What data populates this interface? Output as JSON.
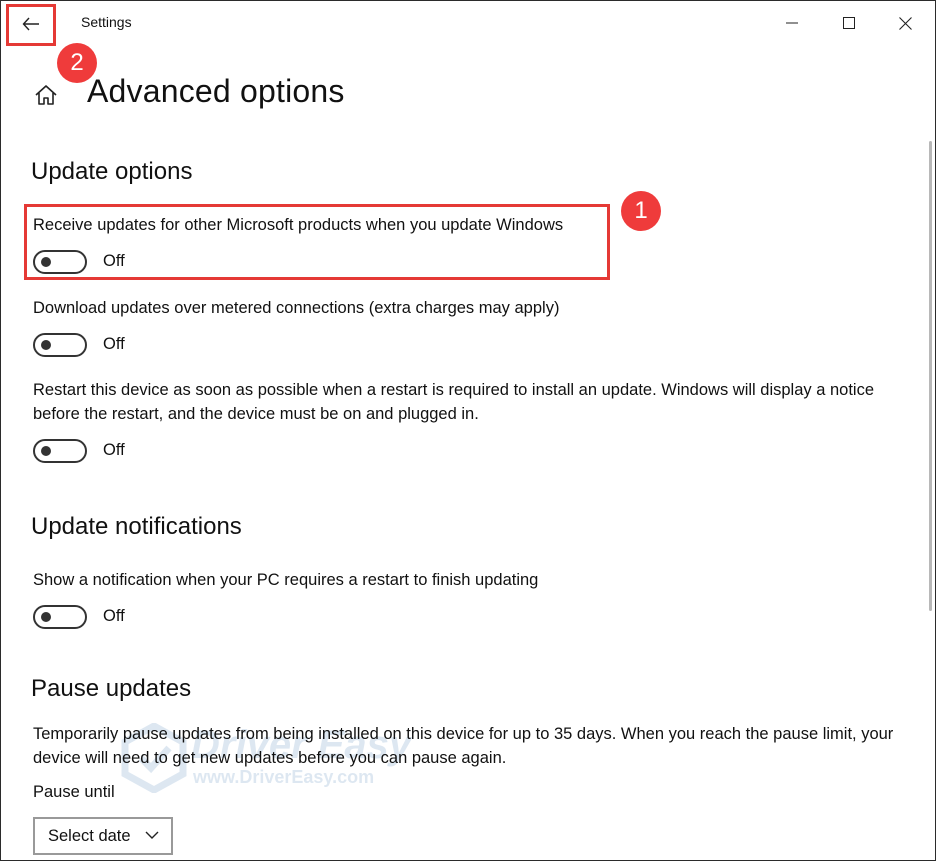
{
  "titlebar": {
    "app_title": "Settings",
    "back_icon": "back-arrow-icon",
    "controls": [
      "minimize-icon",
      "maximize-icon",
      "close-icon"
    ]
  },
  "header": {
    "home_icon": "home-icon",
    "title": "Advanced options"
  },
  "update_options": {
    "title": "Update options",
    "settings": [
      {
        "label": "Receive updates for other Microsoft products when you update Windows",
        "state": "Off"
      },
      {
        "label": "Download updates over metered connections (extra charges may apply)",
        "state": "Off"
      },
      {
        "label": "Restart this device as soon as possible when a restart is required to install an update. Windows will display a notice before the restart, and the device must be on and plugged in.",
        "state": "Off"
      }
    ]
  },
  "update_notifications": {
    "title": "Update notifications",
    "settings": [
      {
        "label": "Show a notification when your PC requires a restart to finish updating",
        "state": "Off"
      }
    ]
  },
  "pause_updates": {
    "title": "Pause updates",
    "description": "Temporarily pause updates from being installed on this device for up to 35 days. When you reach the pause limit, your device will need to get new updates before you can pause again.",
    "pause_until_label": "Pause until",
    "select_value": "Select date"
  },
  "annotations": {
    "callout_1": "1",
    "callout_2": "2",
    "color": "#ef3b3b"
  },
  "watermark": {
    "line1": "Driver Easy",
    "line2": "www.DriverEasy.com"
  }
}
